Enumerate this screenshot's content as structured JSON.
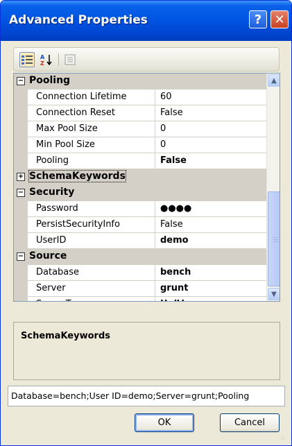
{
  "window": {
    "title": "Advanced Properties",
    "help_glyph": "?",
    "close_glyph": "✕"
  },
  "toolbar": {
    "categorized_icon": "categorized-view-icon",
    "alphabetical_icon": "alphabetical-sort-icon",
    "property_pages_icon": "property-pages-icon"
  },
  "grid": {
    "expand_glyph": "+",
    "collapse_glyph": "−",
    "categories": [
      {
        "name": "Pooling",
        "expanded": true,
        "properties": [
          {
            "name": "Connection Lifetime",
            "value": "60",
            "bold": false
          },
          {
            "name": "Connection Reset",
            "value": "False",
            "bold": false
          },
          {
            "name": "Max Pool Size",
            "value": "0",
            "bold": false
          },
          {
            "name": "Min Pool Size",
            "value": "0",
            "bold": false
          },
          {
            "name": "Pooling",
            "value": "False",
            "bold": true
          }
        ]
      },
      {
        "name": "SchemaKeywords",
        "expanded": false,
        "properties": []
      },
      {
        "name": "Security",
        "expanded": true,
        "properties": [
          {
            "name": "Password",
            "value": "●●●●",
            "bold": true
          },
          {
            "name": "PersistSecurityInfo",
            "value": "False",
            "bold": false
          },
          {
            "name": "UserID",
            "value": "demo",
            "bold": true
          }
        ]
      },
      {
        "name": "Source",
        "expanded": true,
        "properties": [
          {
            "name": "Database",
            "value": "bench",
            "bold": true
          },
          {
            "name": "Server",
            "value": "grunt",
            "bold": true
          },
          {
            "name": "ServerType",
            "value": "UniVerse",
            "bold": true
          }
        ]
      }
    ]
  },
  "description": {
    "title": "SchemaKeywords"
  },
  "connection_string": "Database=bench;User ID=demo;Server=grunt;Pooling",
  "buttons": {
    "ok": "OK",
    "cancel": "Cancel"
  },
  "colors": {
    "title_bar": "#0055e3",
    "category_band": "#d4d0c8",
    "dialog_face": "#ece9d8"
  }
}
